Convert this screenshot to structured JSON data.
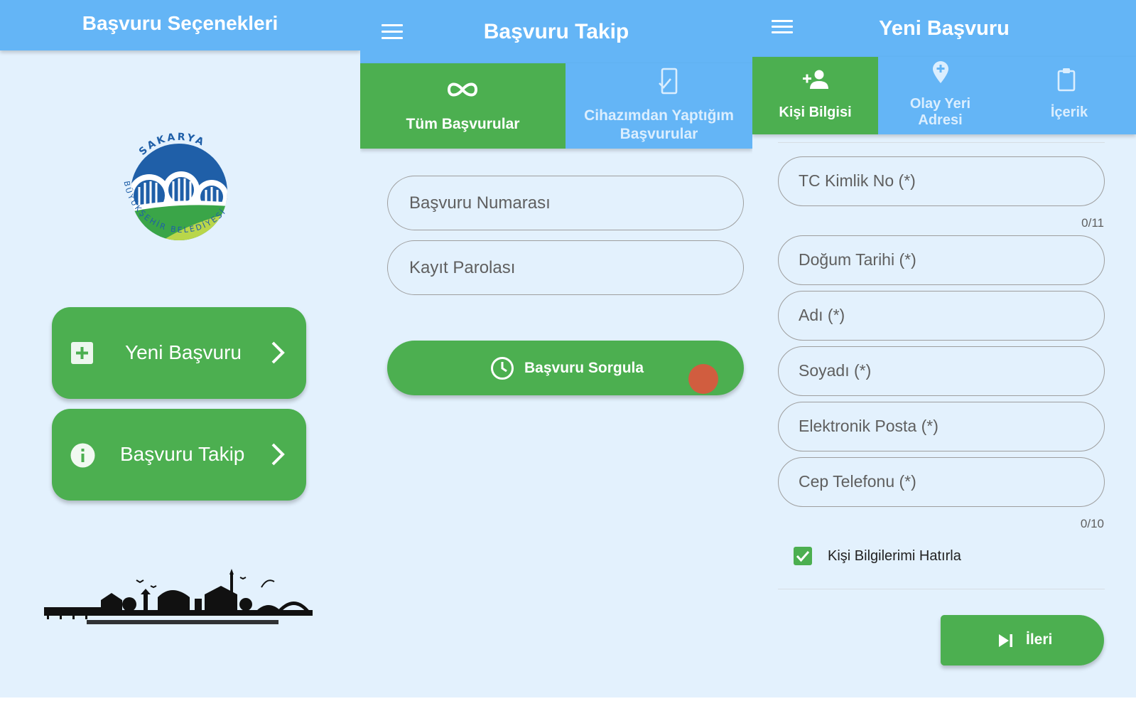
{
  "panel1": {
    "title": "Başvuru Seçenekleri",
    "logo_text_top": "SAKARYA",
    "logo_text_bottom": "BÜYÜKŞEHİR BELEDİYESİ",
    "buttons": [
      {
        "label": "Yeni Başvuru",
        "icon": "plus-box-icon"
      },
      {
        "label": "Başvuru Takip",
        "icon": "info-icon"
      }
    ]
  },
  "panel2": {
    "title": "Başvuru Takip",
    "tabs": [
      {
        "label": "Tüm Başvurular",
        "icon": "infinity-icon"
      },
      {
        "label_line1": "Cihazımdan Yaptığım",
        "label_line2": "Başvurular",
        "icon": "phone-check-icon"
      }
    ],
    "fields": {
      "application_number": "Başvuru Numarası",
      "record_password": "Kayıt Parolası"
    },
    "query_button": "Başvuru Sorgula"
  },
  "panel3": {
    "title": "Yeni Başvuru",
    "tabs": [
      {
        "label": "Kişi Bilgisi",
        "icon": "person-add-icon"
      },
      {
        "label_line1": "Olay Yeri",
        "label_line2": "Adresi",
        "icon": "location-pin-icon"
      },
      {
        "label": "İçerik",
        "icon": "clipboard-icon"
      }
    ],
    "fields": {
      "tc": "TC Kimlik No (*)",
      "tc_counter": "0/11",
      "birth_date": "Doğum Tarihi (*)",
      "name": "Adı (*)",
      "surname": "Soyadı (*)",
      "email": "Elektronik Posta (*)",
      "phone": "Cep Telefonu (*)",
      "phone_counter": "0/10"
    },
    "remember_label": "Kişi Bilgilerimi Hatırla",
    "next_button": "İleri"
  },
  "colors": {
    "appbar": "#64b5f6",
    "green": "#4caf50",
    "background": "#e3f1fd",
    "logo_blue": "#1f5fa8",
    "logo_green": "#3aa548"
  }
}
